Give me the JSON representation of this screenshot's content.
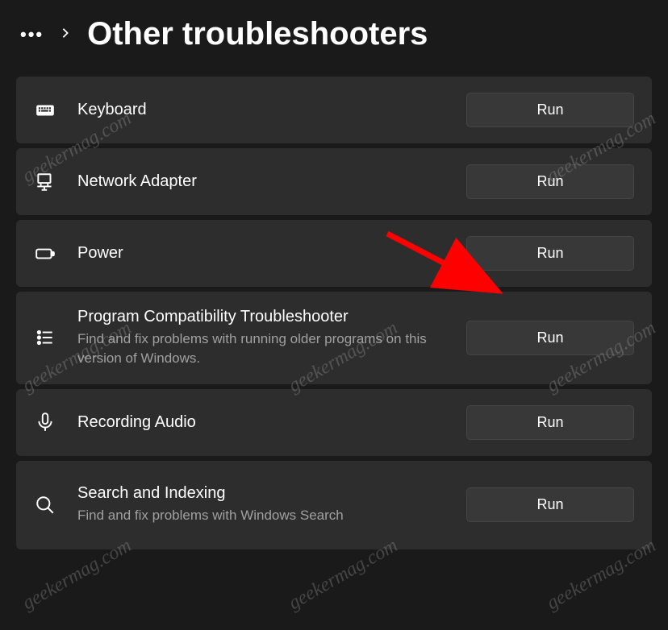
{
  "header": {
    "title": "Other troubleshooters"
  },
  "buttons": {
    "run_label": "Run"
  },
  "items": [
    {
      "id": "keyboard",
      "icon": "keyboard-icon",
      "title": "Keyboard",
      "desc": null
    },
    {
      "id": "network-adapter",
      "icon": "network-adapter-icon",
      "title": "Network Adapter",
      "desc": null
    },
    {
      "id": "power",
      "icon": "power-icon",
      "title": "Power",
      "desc": null
    },
    {
      "id": "program-compatibility",
      "icon": "program-compatibility-icon",
      "title": "Program Compatibility Troubleshooter",
      "desc": "Find and fix problems with running older programs on this version of Windows."
    },
    {
      "id": "recording-audio",
      "icon": "microphone-icon",
      "title": "Recording Audio",
      "desc": null
    },
    {
      "id": "search-indexing",
      "icon": "search-icon",
      "title": "Search and Indexing",
      "desc": "Find and fix problems with Windows Search"
    }
  ],
  "watermark_text": "geekermag.com",
  "annotation": {
    "arrow_target": "power-run-button"
  }
}
